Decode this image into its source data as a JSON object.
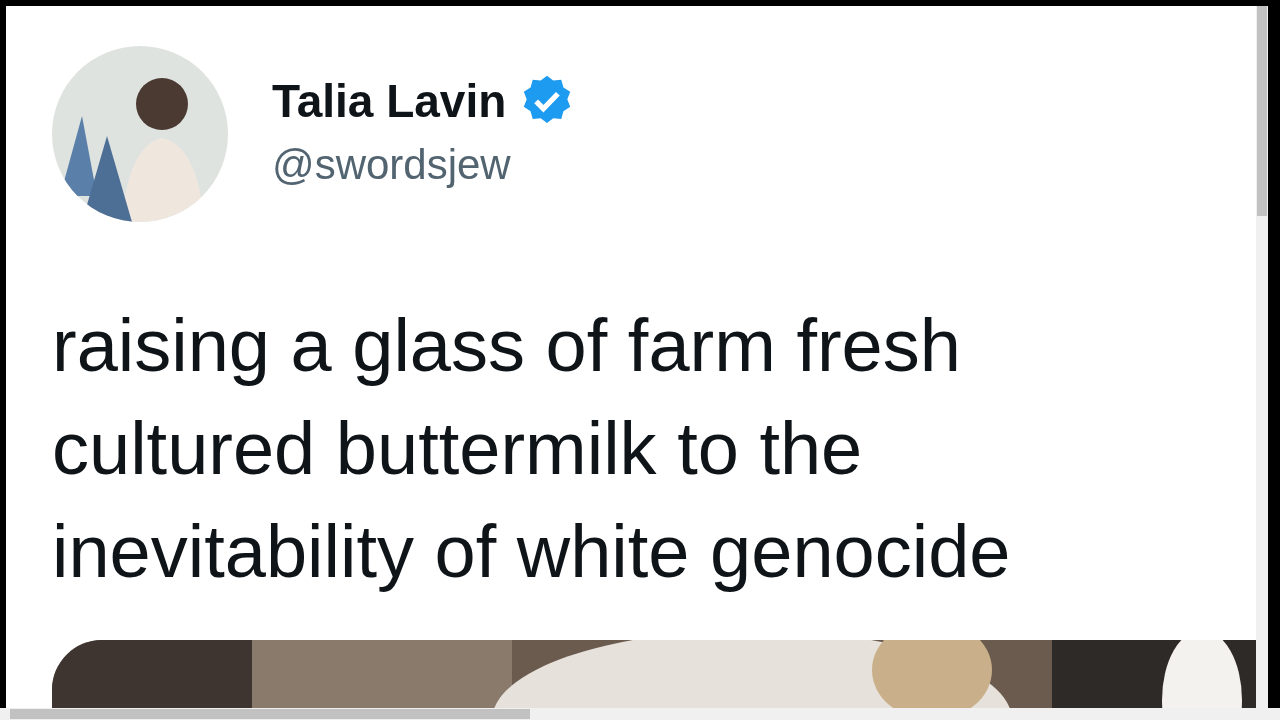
{
  "tweet": {
    "author": {
      "name": "Talia Lavin",
      "handle": "@swordsjew",
      "verified": true
    },
    "text": "raising a glass of farm fresh cultured buttermilk to the inevitability of white genocide"
  }
}
